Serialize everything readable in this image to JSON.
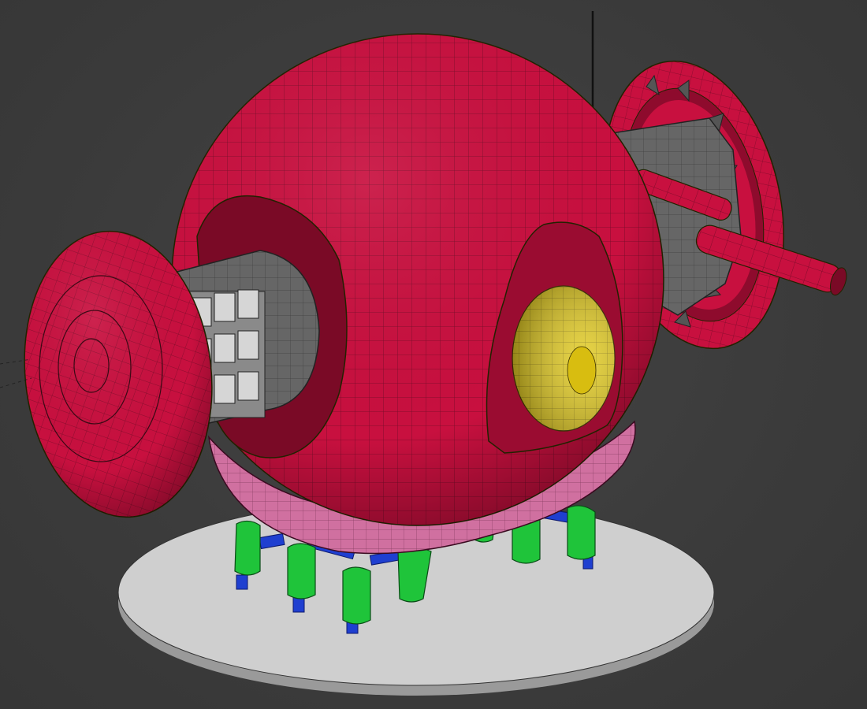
{
  "viewport": {
    "background": "#3a3a3a"
  },
  "model": {
    "colors": {
      "hull": "#c8103f",
      "hull_dark": "#8e0b2d",
      "wire": "#1a0a10",
      "saucer": "#d4a0b8",
      "eye": "#e3cc24",
      "metal": "#6c6c6c",
      "metal_dark": "#4a4a4a",
      "leg_joint": "#1f3fd0",
      "leg_foot": "#1fc43a",
      "platform": "#cfcfcf"
    },
    "icons": [
      "sphere-hull",
      "left-disc",
      "rear-disc",
      "cannon",
      "eye-lens",
      "legs",
      "platform"
    ]
  }
}
